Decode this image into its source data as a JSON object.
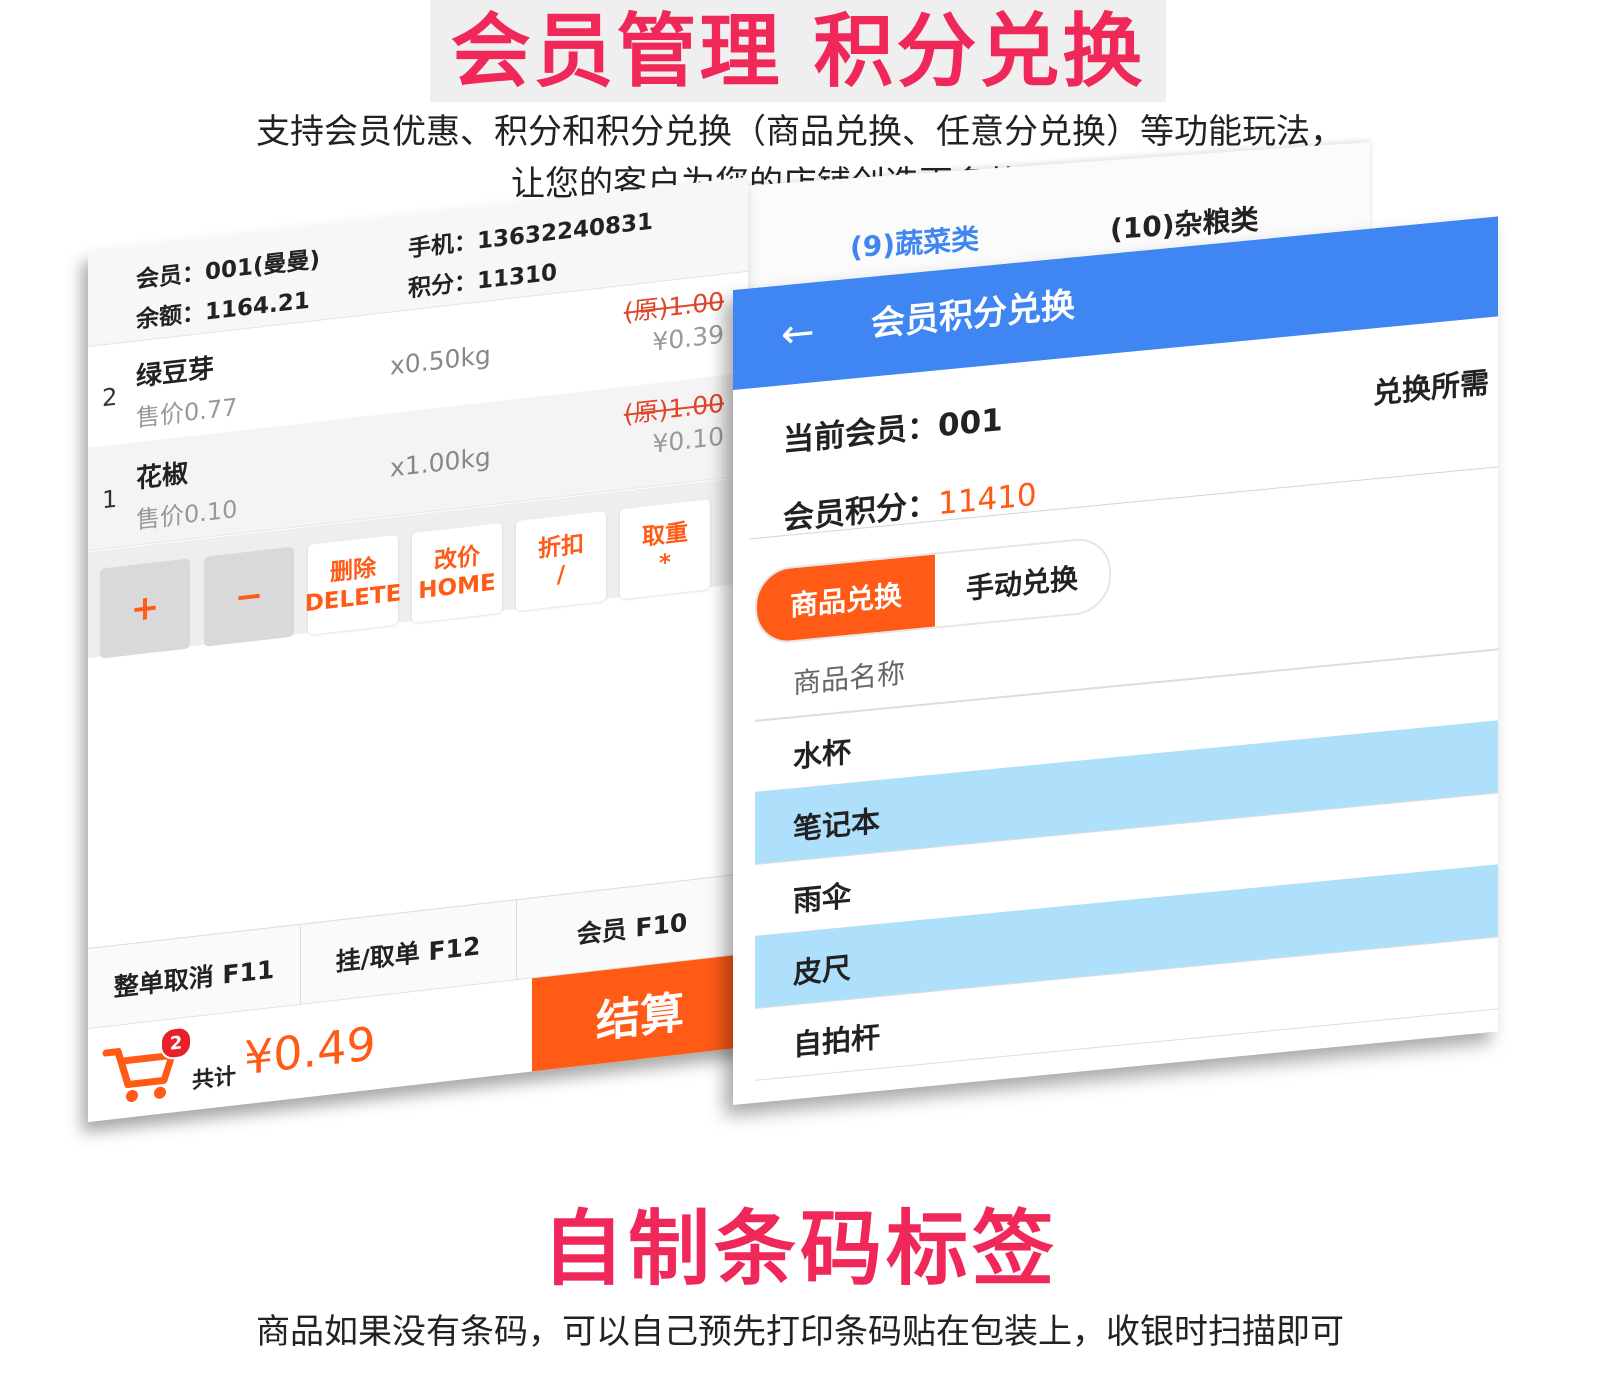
{
  "header": {
    "title": "会员管理 积分兑换",
    "desc_line1": "支持会员优惠、积分和积分兑换（商品兑换、任意分兑换）等功能玩法，",
    "desc_line2": "让您的客户为您的店铺创造更多的价格"
  },
  "pos": {
    "member_label": "会员：001(曼曼)",
    "balance_label": "余额：1164.21",
    "phone_label": "手机：13632240831",
    "points_label": "积分：11310",
    "cart_items": [
      {
        "index": "2",
        "name": "绿豆芽",
        "unit_price": "售价0.77",
        "qty": "x0.50kg",
        "original": "(原)1.00",
        "price": "¥0.39"
      },
      {
        "index": "1",
        "name": "花椒",
        "unit_price": "售价0.10",
        "qty": "x1.00kg",
        "original": "(原)1.00",
        "price": "¥0.10"
      }
    ],
    "keys": {
      "plus": "+",
      "minus": "−",
      "delete_cn": "删除",
      "delete_en": "DELETE",
      "reprice_cn": "改价",
      "reprice_en": "HOME",
      "discount_cn": "折扣",
      "discount_en": "/",
      "weigh_cn": "取重",
      "weigh_en": "*"
    },
    "functions": {
      "cancel_all": "整单取消 F11",
      "hold_order": "挂/取单 F12",
      "member": "会员 F10"
    },
    "cart_count": "2",
    "total_label": "共计",
    "total_value": "¥0.49",
    "checkout": "结算",
    "colors": {
      "accent": "#ff5a16",
      "strike": "#e0462a"
    }
  },
  "categories": {
    "tab_active": "(9)蔬菜类",
    "tab_other": "(10)杂粮类"
  },
  "exchange": {
    "title": "会员积分兑换",
    "back_icon": "arrow-left-icon",
    "current_member_label": "当前会员：",
    "current_member_value": "001",
    "points_label": "会员积分：",
    "points_value": "11410",
    "need_label": "兑换所需",
    "tab_goods": "商品兑换",
    "tab_manual": "手动兑换",
    "column_header": "商品名称",
    "items": [
      "水杯",
      "笔记本",
      "雨伞",
      "皮尺",
      "自拍杆"
    ],
    "colors": {
      "titlebar": "#3f86f2",
      "row_highlight": "#aee0fb"
    }
  },
  "footer": {
    "title": "自制条码标签",
    "desc": "商品如果没有条码，可以自己预先打印条码贴在包装上，收银时扫描即可"
  },
  "brand_colors": {
    "heading": "#f0285a"
  }
}
